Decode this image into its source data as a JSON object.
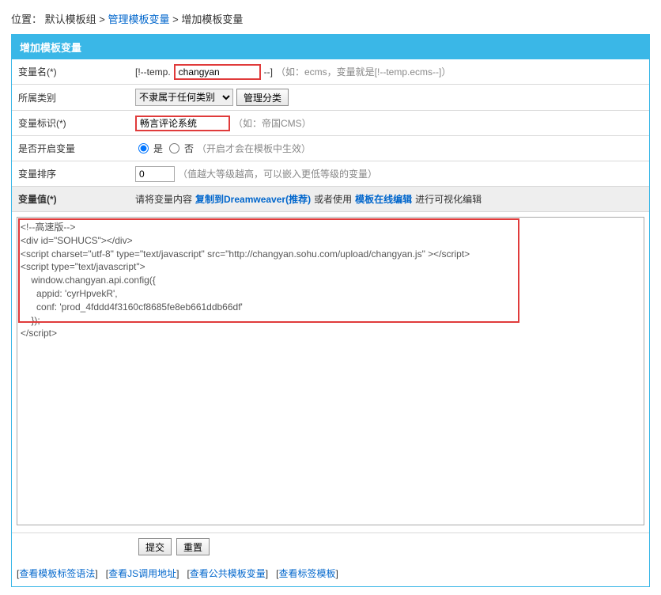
{
  "breadcrumb": {
    "label": "位置：",
    "group": "默认模板组",
    "sep": ">",
    "link1": "管理模板变量",
    "current": "增加模板变量"
  },
  "header": {
    "title": "增加模板变量"
  },
  "row_name": {
    "label": "变量名(*)",
    "prefix": "[!--temp.",
    "value": "changyan",
    "suffix": "--]",
    "hint": "（如：ecms，变量就是[!--temp.ecms--]）"
  },
  "row_cat": {
    "label": "所属类别",
    "selected": "不隶属于任何类别",
    "btn": "管理分类"
  },
  "row_mark": {
    "label": "变量标识(*)",
    "value": "畅言评论系统",
    "hint": "（如：帝国CMS）"
  },
  "row_enable": {
    "label": "是否开启变量",
    "yes": "是",
    "no": "否",
    "hint": "（开启才会在模板中生效）"
  },
  "row_order": {
    "label": "变量排序",
    "value": "0",
    "hint": "（值越大等级越高，可以嵌入更低等级的变量）"
  },
  "row_value": {
    "label": "变量值(*)",
    "msg_pre": "请将变量内容",
    "link1": "复制到Dreamweaver(推荐)",
    "msg_mid": "或者使用",
    "link2": "模板在线编辑",
    "msg_post": "进行可视化编辑"
  },
  "textarea_value": "<!--高速版-->\n<div id=\"SOHUCS\"></div>\n<script charset=\"utf-8\" type=\"text/javascript\" src=\"http://changyan.sohu.com/upload/changyan.js\" ></script>\n<script type=\"text/javascript\">\n    window.changyan.api.config({\n      appid: 'cyrHpvekR',\n      conf: 'prod_4fddd4f3160cf8685fe8eb661ddb66df'\n    });\n</script>",
  "buttons": {
    "submit": "提交",
    "reset": "重置"
  },
  "footer_links": {
    "l1": "查看模板标签语法",
    "l2": "查看JS调用地址",
    "l3": "查看公共模板变量",
    "l4": "查看标签模板"
  }
}
